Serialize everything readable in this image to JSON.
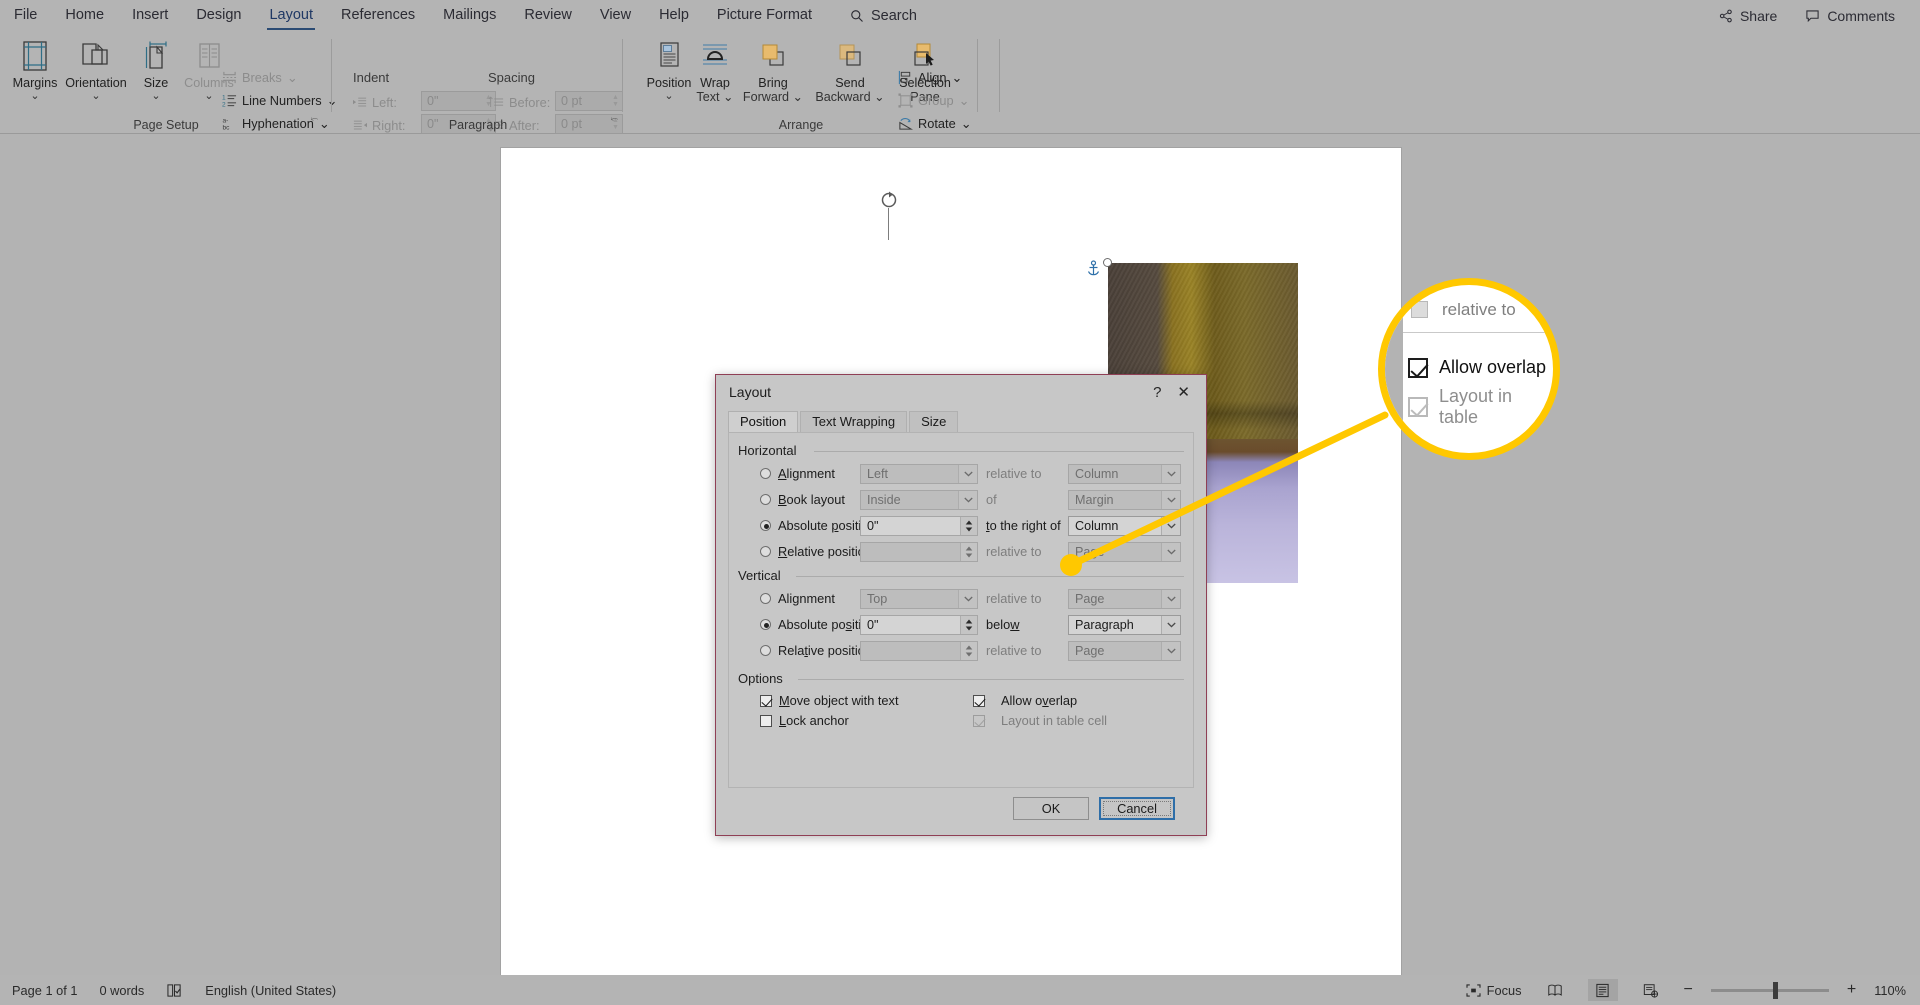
{
  "app": {
    "tabs": [
      {
        "label": "File",
        "active": false
      },
      {
        "label": "Home",
        "active": false
      },
      {
        "label": "Insert",
        "active": false
      },
      {
        "label": "Design",
        "active": false
      },
      {
        "label": "Layout",
        "active": true
      },
      {
        "label": "References",
        "active": false
      },
      {
        "label": "Mailings",
        "active": false
      },
      {
        "label": "Review",
        "active": false
      },
      {
        "label": "View",
        "active": false
      },
      {
        "label": "Help",
        "active": false
      },
      {
        "label": "Picture Format",
        "active": false
      }
    ],
    "search_label": "Search",
    "share_label": "Share",
    "comments_label": "Comments"
  },
  "ribbon": {
    "page_setup": {
      "label": "Page Setup",
      "buttons": [
        {
          "label": "Margins",
          "icon": "margins-icon",
          "disabled": false
        },
        {
          "label": "Orientation",
          "icon": "orientation-icon",
          "disabled": false
        },
        {
          "label": "Size",
          "icon": "size-icon",
          "disabled": false
        },
        {
          "label": "Columns",
          "icon": "columns-icon",
          "disabled": true
        }
      ],
      "small_buttons": [
        {
          "label": "Breaks",
          "icon": "breaks-icon",
          "disabled": true
        },
        {
          "label": "Line Numbers",
          "icon": "line-numbers-icon",
          "disabled": false
        },
        {
          "label": "Hyphenation",
          "icon": "hyphenation-icon",
          "disabled": false
        }
      ]
    },
    "paragraph": {
      "label": "Paragraph",
      "indent_header": "Indent",
      "spacing_header": "Spacing",
      "left_label": "Left:",
      "right_label": "Right:",
      "before_label": "Before:",
      "after_label": "After:",
      "left_value": "0\"",
      "right_value": "0\"",
      "before_value": "0 pt",
      "after_value": "0 pt"
    },
    "arrange": {
      "label": "Arrange",
      "buttons": [
        {
          "label": "Position",
          "icon": "position-icon"
        },
        {
          "label": "Wrap Text",
          "icon": "wrap-text-icon"
        },
        {
          "label": "Bring Forward",
          "icon": "bring-forward-icon"
        },
        {
          "label": "Send Backward",
          "icon": "send-backward-icon"
        },
        {
          "label": "Selection Pane",
          "icon": "selection-pane-icon"
        }
      ],
      "small_buttons": [
        {
          "label": "Align",
          "icon": "align-icon",
          "disabled": false
        },
        {
          "label": "Group",
          "icon": "group-icon",
          "disabled": true
        },
        {
          "label": "Rotate",
          "icon": "rotate-icon",
          "disabled": false
        }
      ]
    }
  },
  "dialog": {
    "title": "Layout",
    "help_label": "?",
    "close_label": "✕",
    "tabs": [
      {
        "label": "Position",
        "active": true
      },
      {
        "label": "Text Wrapping",
        "active": false
      },
      {
        "label": "Size",
        "active": false
      }
    ],
    "horizontal": {
      "legend": "Horizontal",
      "rows": [
        {
          "radio_label": "Alignment",
          "underline": "A",
          "selected": false,
          "value": "Left",
          "value_enabled": false,
          "mid_label": "relative to",
          "mid_enabled": false,
          "right_value": "Column",
          "right_enabled": false,
          "control": "combo"
        },
        {
          "radio_label": "Book layout",
          "underline": "B",
          "selected": false,
          "value": "Inside",
          "value_enabled": false,
          "mid_label": "of",
          "mid_enabled": false,
          "right_value": "Margin",
          "right_enabled": false,
          "control": "combo"
        },
        {
          "radio_label": "Absolute position",
          "underline": "p",
          "selected": true,
          "value": "0\"",
          "value_enabled": true,
          "mid_label": "to the right of",
          "mid_enabled": true,
          "right_value": "Column",
          "right_enabled": true,
          "control": "spin"
        },
        {
          "radio_label": "Relative position",
          "underline": "R",
          "selected": false,
          "value": "",
          "value_enabled": false,
          "mid_label": "relative to",
          "mid_enabled": false,
          "right_value": "Page",
          "right_enabled": false,
          "control": "spin"
        }
      ]
    },
    "vertical": {
      "legend": "Vertical",
      "rows": [
        {
          "radio_label": "Alignment",
          "underline": "g",
          "selected": false,
          "value": "Top",
          "value_enabled": false,
          "mid_label": "relative to",
          "mid_enabled": false,
          "right_value": "Page",
          "right_enabled": false,
          "control": "combo"
        },
        {
          "radio_label": "Absolute position",
          "underline": "s",
          "selected": true,
          "value": "0\"",
          "value_enabled": true,
          "mid_label": "below",
          "mid_enabled": true,
          "right_value": "Paragraph",
          "right_enabled": true,
          "control": "spin"
        },
        {
          "radio_label": "Relative position",
          "underline": "t",
          "selected": false,
          "value": "",
          "value_enabled": false,
          "mid_label": "relative to",
          "mid_enabled": false,
          "right_value": "Page",
          "right_enabled": false,
          "control": "spin"
        }
      ]
    },
    "options": {
      "legend": "Options",
      "items": [
        {
          "label": "Move object with text",
          "checked": true,
          "enabled": true,
          "col": "left"
        },
        {
          "label": "Lock anchor",
          "checked": false,
          "enabled": true,
          "col": "left"
        },
        {
          "label": "Allow overlap",
          "checked": true,
          "enabled": true,
          "col": "right"
        },
        {
          "label": "Layout in table cell",
          "checked": true,
          "enabled": false,
          "col": "right"
        }
      ]
    },
    "ok_label": "OK",
    "cancel_label": "Cancel"
  },
  "callout": {
    "top_text": "relative to",
    "items": [
      {
        "label": "Allow overlap",
        "checked": true,
        "enabled": true
      },
      {
        "label": "Layout in table",
        "checked": true,
        "enabled": false
      }
    ],
    "highlight_color": "#ffc800"
  },
  "status": {
    "page": "Page 1 of 1",
    "words": "0 words",
    "proofing_icon": "proofing-icon",
    "language": "English (United States)",
    "focus_label": "Focus",
    "views": [
      "read-mode-icon",
      "print-layout-icon",
      "web-layout-icon"
    ],
    "zoom_out": "−",
    "zoom_in": "+",
    "zoom_level": "110%"
  }
}
